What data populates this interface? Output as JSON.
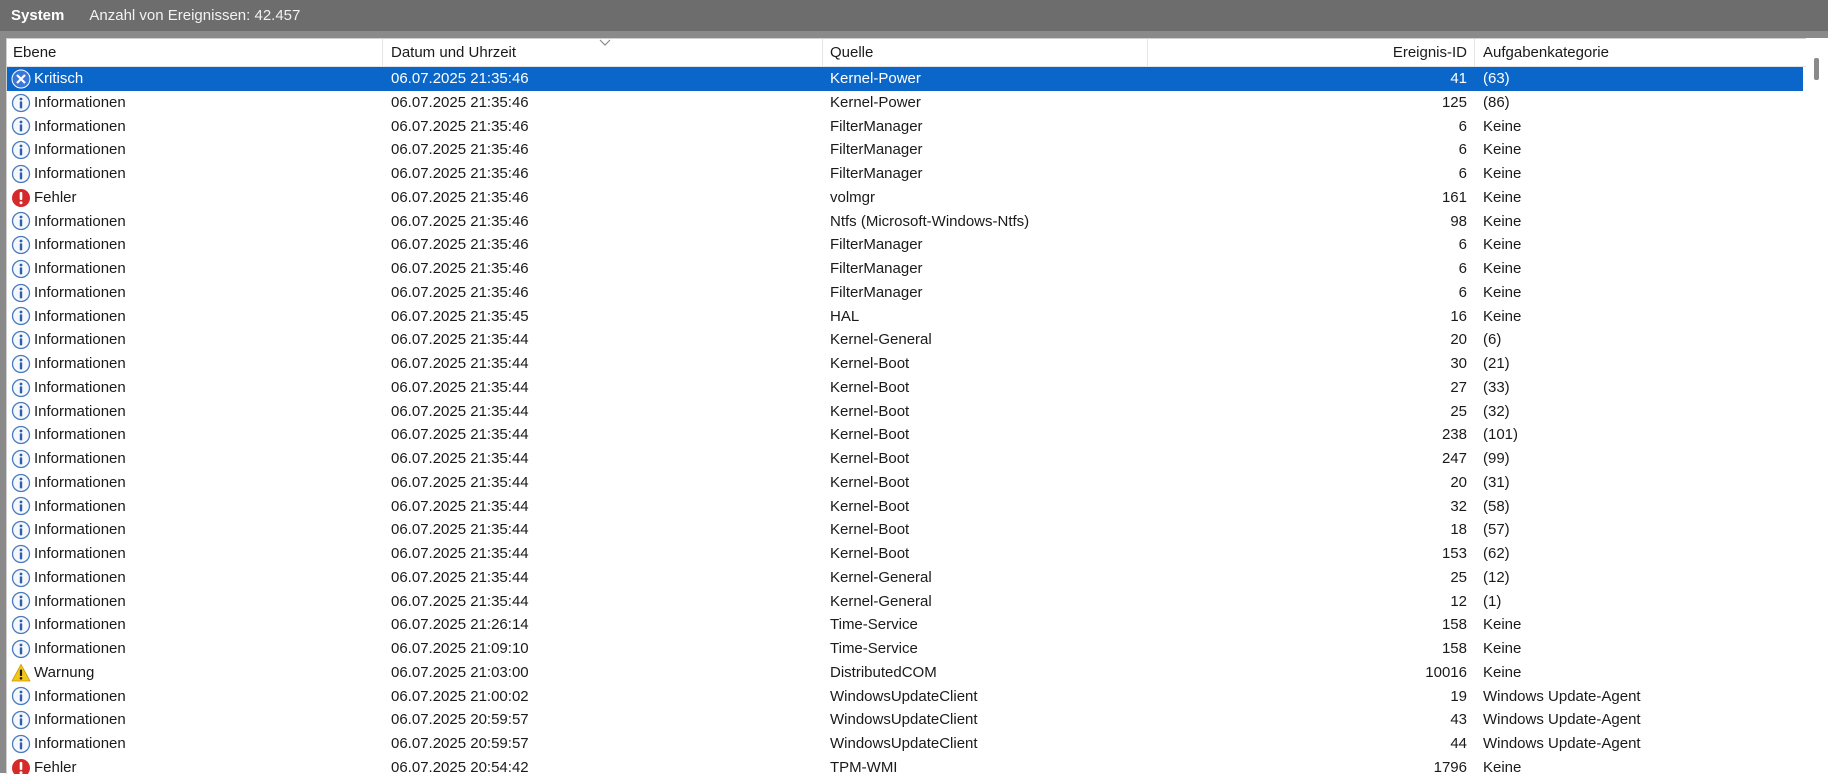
{
  "titlebar": {
    "log_name": "System",
    "event_count": "Anzahl von Ereignissen: 42.457"
  },
  "columns": {
    "level": "Ebene",
    "date": "Datum und Uhrzeit",
    "source": "Quelle",
    "event_id": "Ereignis-ID",
    "category": "Aufgabenkategorie"
  },
  "rows": [
    {
      "level": "Kritisch",
      "icon": "critical-icon",
      "date": "06.07.2025 21:35:46",
      "source": "Kernel-Power",
      "event_id": "41",
      "category": "(63)",
      "selected": true
    },
    {
      "level": "Informationen",
      "icon": "info-icon",
      "date": "06.07.2025 21:35:46",
      "source": "Kernel-Power",
      "event_id": "125",
      "category": "(86)"
    },
    {
      "level": "Informationen",
      "icon": "info-icon",
      "date": "06.07.2025 21:35:46",
      "source": "FilterManager",
      "event_id": "6",
      "category": "Keine"
    },
    {
      "level": "Informationen",
      "icon": "info-icon",
      "date": "06.07.2025 21:35:46",
      "source": "FilterManager",
      "event_id": "6",
      "category": "Keine"
    },
    {
      "level": "Informationen",
      "icon": "info-icon",
      "date": "06.07.2025 21:35:46",
      "source": "FilterManager",
      "event_id": "6",
      "category": "Keine"
    },
    {
      "level": "Fehler",
      "icon": "error-icon",
      "date": "06.07.2025 21:35:46",
      "source": "volmgr",
      "event_id": "161",
      "category": "Keine"
    },
    {
      "level": "Informationen",
      "icon": "info-icon",
      "date": "06.07.2025 21:35:46",
      "source": "Ntfs (Microsoft-Windows-Ntfs)",
      "event_id": "98",
      "category": "Keine"
    },
    {
      "level": "Informationen",
      "icon": "info-icon",
      "date": "06.07.2025 21:35:46",
      "source": "FilterManager",
      "event_id": "6",
      "category": "Keine"
    },
    {
      "level": "Informationen",
      "icon": "info-icon",
      "date": "06.07.2025 21:35:46",
      "source": "FilterManager",
      "event_id": "6",
      "category": "Keine"
    },
    {
      "level": "Informationen",
      "icon": "info-icon",
      "date": "06.07.2025 21:35:46",
      "source": "FilterManager",
      "event_id": "6",
      "category": "Keine"
    },
    {
      "level": "Informationen",
      "icon": "info-icon",
      "date": "06.07.2025 21:35:45",
      "source": "HAL",
      "event_id": "16",
      "category": "Keine"
    },
    {
      "level": "Informationen",
      "icon": "info-icon",
      "date": "06.07.2025 21:35:44",
      "source": "Kernel-General",
      "event_id": "20",
      "category": "(6)"
    },
    {
      "level": "Informationen",
      "icon": "info-icon",
      "date": "06.07.2025 21:35:44",
      "source": "Kernel-Boot",
      "event_id": "30",
      "category": "(21)"
    },
    {
      "level": "Informationen",
      "icon": "info-icon",
      "date": "06.07.2025 21:35:44",
      "source": "Kernel-Boot",
      "event_id": "27",
      "category": "(33)"
    },
    {
      "level": "Informationen",
      "icon": "info-icon",
      "date": "06.07.2025 21:35:44",
      "source": "Kernel-Boot",
      "event_id": "25",
      "category": "(32)"
    },
    {
      "level": "Informationen",
      "icon": "info-icon",
      "date": "06.07.2025 21:35:44",
      "source": "Kernel-Boot",
      "event_id": "238",
      "category": "(101)"
    },
    {
      "level": "Informationen",
      "icon": "info-icon",
      "date": "06.07.2025 21:35:44",
      "source": "Kernel-Boot",
      "event_id": "247",
      "category": "(99)"
    },
    {
      "level": "Informationen",
      "icon": "info-icon",
      "date": "06.07.2025 21:35:44",
      "source": "Kernel-Boot",
      "event_id": "20",
      "category": "(31)"
    },
    {
      "level": "Informationen",
      "icon": "info-icon",
      "date": "06.07.2025 21:35:44",
      "source": "Kernel-Boot",
      "event_id": "32",
      "category": "(58)"
    },
    {
      "level": "Informationen",
      "icon": "info-icon",
      "date": "06.07.2025 21:35:44",
      "source": "Kernel-Boot",
      "event_id": "18",
      "category": "(57)"
    },
    {
      "level": "Informationen",
      "icon": "info-icon",
      "date": "06.07.2025 21:35:44",
      "source": "Kernel-Boot",
      "event_id": "153",
      "category": "(62)"
    },
    {
      "level": "Informationen",
      "icon": "info-icon",
      "date": "06.07.2025 21:35:44",
      "source": "Kernel-General",
      "event_id": "25",
      "category": "(12)"
    },
    {
      "level": "Informationen",
      "icon": "info-icon",
      "date": "06.07.2025 21:35:44",
      "source": "Kernel-General",
      "event_id": "12",
      "category": "(1)"
    },
    {
      "level": "Informationen",
      "icon": "info-icon",
      "date": "06.07.2025 21:26:14",
      "source": "Time-Service",
      "event_id": "158",
      "category": "Keine"
    },
    {
      "level": "Informationen",
      "icon": "info-icon",
      "date": "06.07.2025 21:09:10",
      "source": "Time-Service",
      "event_id": "158",
      "category": "Keine"
    },
    {
      "level": "Warnung",
      "icon": "warning-icon",
      "date": "06.07.2025 21:03:00",
      "source": "DistributedCOM",
      "event_id": "10016",
      "category": "Keine"
    },
    {
      "level": "Informationen",
      "icon": "info-icon",
      "date": "06.07.2025 21:00:02",
      "source": "WindowsUpdateClient",
      "event_id": "19",
      "category": "Windows Update-Agent"
    },
    {
      "level": "Informationen",
      "icon": "info-icon",
      "date": "06.07.2025 20:59:57",
      "source": "WindowsUpdateClient",
      "event_id": "43",
      "category": "Windows Update-Agent"
    },
    {
      "level": "Informationen",
      "icon": "info-icon",
      "date": "06.07.2025 20:59:57",
      "source": "WindowsUpdateClient",
      "event_id": "44",
      "category": "Windows Update-Agent"
    },
    {
      "level": "Fehler",
      "icon": "error-icon",
      "date": "06.07.2025 20:54:42",
      "source": "TPM-WMI",
      "event_id": "1796",
      "category": "Keine"
    }
  ],
  "colors": {
    "selection": "#0a66c9",
    "titlebar": "#6d6d6d",
    "info_icon": "#4a7bc0",
    "error_icon": "#d42a2a",
    "warning_icon": "#f5c518",
    "critical_icon": "#3a78d8"
  }
}
